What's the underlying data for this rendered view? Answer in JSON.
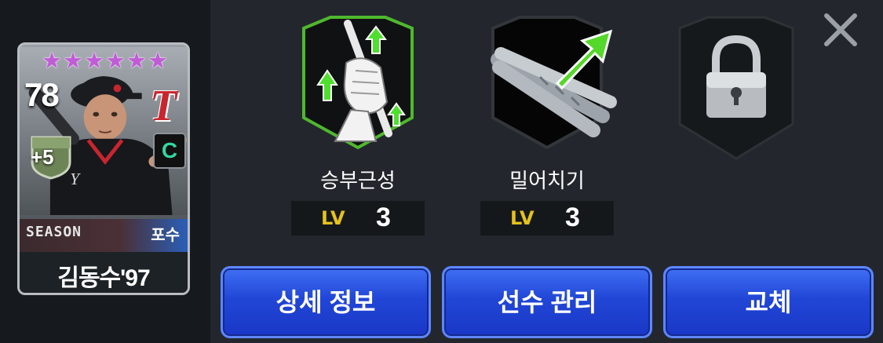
{
  "player_card": {
    "stars": 6,
    "ovr": "78",
    "boost": "+5",
    "grade": "C",
    "season": "SEASON",
    "position": "포수",
    "name": "김동수'97",
    "star_color": "#c25bd8",
    "grade_color": "#33d6a0"
  },
  "skills": [
    {
      "name": "승부근성",
      "lv_label": "LV",
      "level": "3",
      "icon": "batting-grip-icon",
      "frame_color": "#4fb82e"
    },
    {
      "name": "밀어치기",
      "lv_label": "LV",
      "level": "3",
      "icon": "bat-push-icon",
      "frame_color": "#2a2d31"
    },
    {
      "name": "",
      "lv_label": "",
      "level": "",
      "icon": "lock-icon",
      "locked": true
    }
  ],
  "buttons": {
    "detail": "상세 정보",
    "manage": "선수 관리",
    "replace": "교체"
  },
  "close_icon": "close-icon",
  "colors": {
    "button_blue": "#2146d6",
    "lv_gold": "#e5c21d",
    "background": "#23272d"
  }
}
